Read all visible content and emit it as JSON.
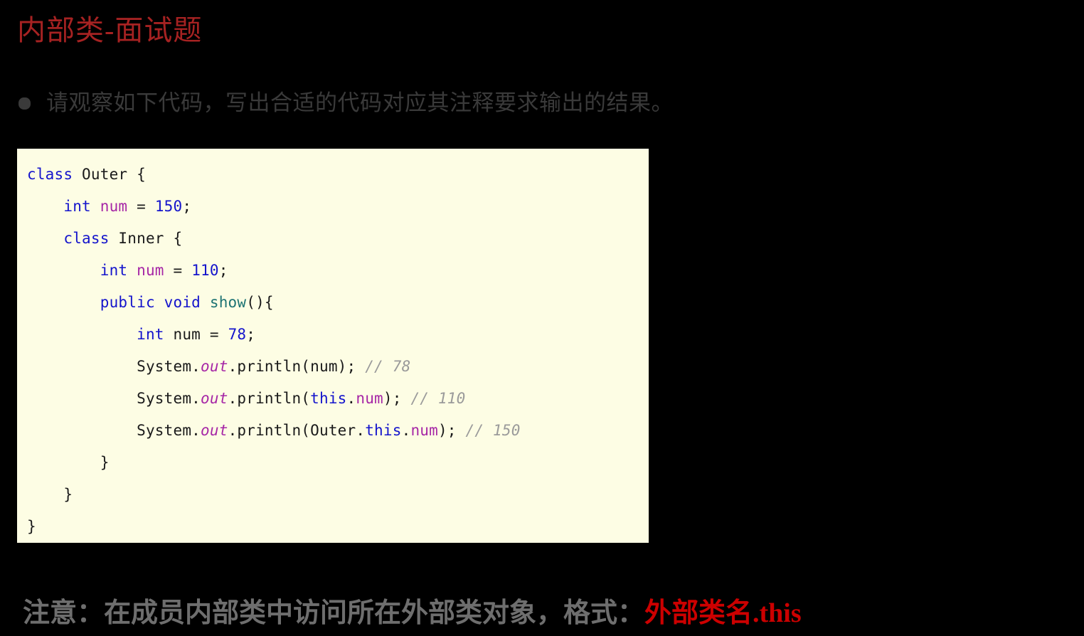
{
  "slide": {
    "title": "内部类-面试题",
    "title_color": "#a62222",
    "background_color": "#000000"
  },
  "bullet": {
    "marker": "round-bullet",
    "text": "请观察如下代码，写出合适的代码对应其注释要求输出的结果。",
    "color": "#3a3a3a"
  },
  "code_block": {
    "background_color": "#fdfde4",
    "language": "java",
    "palette": {
      "keyword": "#1414cc",
      "number": "#1414cc",
      "field": "#a626a6",
      "method": "#1d7373",
      "static_field": "#a626a6",
      "comment": "#9a9a9a",
      "plain": "#1a1a1a"
    },
    "lines": [
      {
        "indent": 0,
        "tokens": [
          {
            "t": "class",
            "c": "kw"
          },
          {
            "t": " Outer {",
            "c": "plain"
          }
        ]
      },
      {
        "indent": 1,
        "tokens": [
          {
            "t": "int",
            "c": "kw"
          },
          {
            "t": " ",
            "c": "plain"
          },
          {
            "t": "num",
            "c": "field"
          },
          {
            "t": " = ",
            "c": "plain"
          },
          {
            "t": "150",
            "c": "num-lit"
          },
          {
            "t": ";",
            "c": "plain"
          }
        ]
      },
      {
        "indent": 1,
        "tokens": [
          {
            "t": "class",
            "c": "kw"
          },
          {
            "t": " Inner {",
            "c": "plain"
          }
        ]
      },
      {
        "indent": 2,
        "tokens": [
          {
            "t": "int",
            "c": "kw"
          },
          {
            "t": " ",
            "c": "plain"
          },
          {
            "t": "num",
            "c": "field"
          },
          {
            "t": " = ",
            "c": "plain"
          },
          {
            "t": "110",
            "c": "num-lit"
          },
          {
            "t": ";",
            "c": "plain"
          }
        ]
      },
      {
        "indent": 2,
        "tokens": [
          {
            "t": "public",
            "c": "kw"
          },
          {
            "t": " ",
            "c": "plain"
          },
          {
            "t": "void",
            "c": "kw"
          },
          {
            "t": " ",
            "c": "plain"
          },
          {
            "t": "show",
            "c": "method"
          },
          {
            "t": "(){",
            "c": "plain"
          }
        ]
      },
      {
        "indent": 3,
        "tokens": [
          {
            "t": "int",
            "c": "kw"
          },
          {
            "t": " num = ",
            "c": "plain"
          },
          {
            "t": "78",
            "c": "num-lit"
          },
          {
            "t": ";",
            "c": "plain"
          }
        ]
      },
      {
        "indent": 3,
        "tokens": [
          {
            "t": "System.",
            "c": "plain"
          },
          {
            "t": "out",
            "c": "static-f"
          },
          {
            "t": ".println(num); ",
            "c": "plain"
          },
          {
            "t": "// 78",
            "c": "cmt"
          }
        ]
      },
      {
        "indent": 3,
        "tokens": [
          {
            "t": "System.",
            "c": "plain"
          },
          {
            "t": "out",
            "c": "static-f"
          },
          {
            "t": ".println(",
            "c": "plain"
          },
          {
            "t": "this",
            "c": "kw"
          },
          {
            "t": ".",
            "c": "plain"
          },
          {
            "t": "num",
            "c": "field"
          },
          {
            "t": "); ",
            "c": "plain"
          },
          {
            "t": "// 110",
            "c": "cmt"
          }
        ]
      },
      {
        "indent": 3,
        "tokens": [
          {
            "t": "System.",
            "c": "plain"
          },
          {
            "t": "out",
            "c": "static-f"
          },
          {
            "t": ".println(Outer.",
            "c": "plain"
          },
          {
            "t": "this",
            "c": "kw"
          },
          {
            "t": ".",
            "c": "plain"
          },
          {
            "t": "num",
            "c": "field"
          },
          {
            "t": "); ",
            "c": "plain"
          },
          {
            "t": "// 150",
            "c": "cmt"
          }
        ]
      },
      {
        "indent": 2,
        "tokens": [
          {
            "t": "}",
            "c": "plain"
          }
        ]
      },
      {
        "indent": 1,
        "tokens": [
          {
            "t": "}",
            "c": "plain"
          }
        ]
      },
      {
        "indent": 0,
        "tokens": [
          {
            "t": "}",
            "c": "plain"
          }
        ]
      }
    ]
  },
  "bottom_note": {
    "lead": "注意：在成员内部类中访问所在外部类对象，格式：",
    "emphasis": "外部类名.this",
    "lead_color": "#6e6e6e",
    "emphasis_color": "#cc0000"
  }
}
